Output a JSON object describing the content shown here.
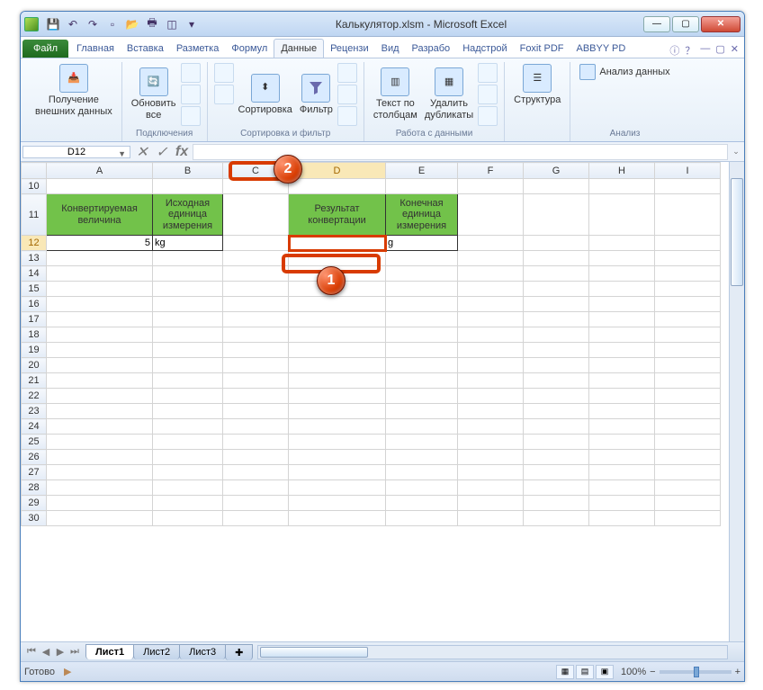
{
  "window": {
    "title": "Калькулятор.xlsm - Microsoft Excel"
  },
  "qat": {
    "icons": [
      "save",
      "undo",
      "redo",
      "new",
      "open",
      "print",
      "preview",
      "spell"
    ]
  },
  "ribbonTabs": {
    "file": "Файл",
    "tabs": [
      "Главная",
      "Вставка",
      "Разметка",
      "Формул",
      "Данные",
      "Рецензи",
      "Вид",
      "Разрабо",
      "Надстрой",
      "Foxit PDF",
      "ABBYY PD"
    ],
    "active": "Данные"
  },
  "ribbon": {
    "g1": {
      "btn": "Получение\nвнешних данных"
    },
    "g2": {
      "btn": "Обновить\nвсе",
      "label": "Подключения"
    },
    "g3": {
      "sort": "Сортировка",
      "filter": "Фильтр",
      "label": "Сортировка и фильтр"
    },
    "g4": {
      "text": "Текст по\nстолбцам",
      "dup": "Удалить\nдубликаты",
      "label": "Работа с данными"
    },
    "g5": {
      "btn": "Структура"
    },
    "g6": {
      "btn": "Анализ данных",
      "label": "Анализ"
    }
  },
  "namebox": "D12",
  "columns": [
    "A",
    "B",
    "C",
    "D",
    "E",
    "F",
    "G",
    "H",
    "I"
  ],
  "rows": [
    10,
    11,
    12,
    13,
    14,
    15,
    16,
    17,
    18,
    19,
    20,
    21,
    22,
    23,
    24,
    25,
    26,
    27,
    28,
    29,
    30
  ],
  "headers": {
    "A": "Конвертируемая\nвеличина",
    "B": "Исходная\nединица\nизмерения",
    "D": "Результат\nконвертации",
    "E": "Конечная\nединица\nизмерения"
  },
  "data": {
    "A12": "5",
    "B12": "kg",
    "D12": "",
    "E12": "g"
  },
  "sheets": {
    "tabs": [
      "Лист1",
      "Лист2",
      "Лист3"
    ],
    "active": "Лист1"
  },
  "status": {
    "ready": "Готово",
    "zoom": "100%"
  },
  "markers": {
    "m1": "1",
    "m2": "2"
  }
}
